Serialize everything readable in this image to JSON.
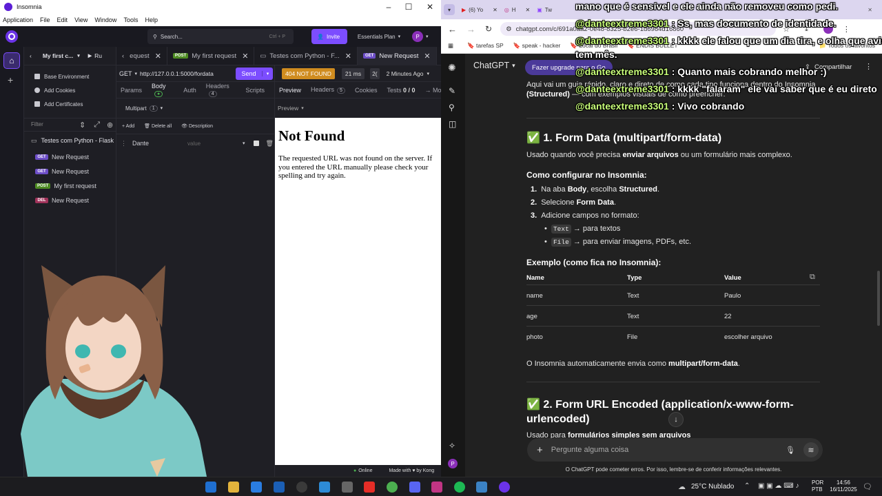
{
  "insomnia": {
    "window_title": "Insomnia",
    "menu": [
      "Application",
      "File",
      "Edit",
      "View",
      "Window",
      "Tools",
      "Help"
    ],
    "search_placeholder": "Search...",
    "search_shortcut": "Ctrl + P",
    "invite_label": "Invite",
    "plan_label": "Essentials Plan",
    "avatar_letter": "P",
    "collection_short": "My first c...",
    "run_label": "Ru",
    "side_links": [
      "Base Environment",
      "Add Cookies",
      "Add Certificates"
    ],
    "filter_placeholder": "Filter",
    "collection_name": "Testes com Python - Flask",
    "requests": [
      {
        "method": "GET",
        "name": "New Request"
      },
      {
        "method": "GET",
        "name": "New Request"
      },
      {
        "method": "POST",
        "name": "My first request"
      },
      {
        "method": "DEL",
        "name": "New Request"
      }
    ],
    "tabs": [
      {
        "label": "equest",
        "method": "",
        "active": false
      },
      {
        "label": "My first request",
        "method": "POST",
        "active": false
      },
      {
        "label": "Testes com Python - F...",
        "method": "",
        "active": false
      },
      {
        "label": "New Request",
        "method": "GET",
        "active": true
      }
    ],
    "request": {
      "method": "GET",
      "url": "http://127.0.0.1:5000/fordata",
      "send_label": "Send",
      "subtabs": [
        "Params",
        "Body",
        "Auth",
        "Headers",
        "Scripts"
      ],
      "headers_count": "4",
      "body_type": "Multipart",
      "body_count": "1",
      "add_label": "Add",
      "delete_all_label": "Delete all",
      "description_label": "Description",
      "field_name": "Dante",
      "field_value_placeholder": "value"
    },
    "response": {
      "status": "404 NOT FOUND",
      "time": "21 ms",
      "size": "2(",
      "ago": "2 Minutes Ago",
      "subtabs": [
        "Preview",
        "Headers",
        "Cookies",
        "Tests",
        "→ Mock"
      ],
      "headers_count": "5",
      "tests_count": "0 / 0",
      "preview_label": "Preview",
      "heading": "Not Found",
      "message": "The requested URL was not found on the server. If you entered the URL manually please check your spelling and try again."
    },
    "footer_online": "Online",
    "footer_made": "Made with ♥ by Kong"
  },
  "chrome": {
    "tabs": [
      "(6) Yo",
      "H",
      "Tw"
    ],
    "address": "chatgpt.com/c/691a0aa2-0e48-8325-b2e6-1d6984d16860",
    "bookmarks": [
      "tarefas SP",
      "speak - hacker",
      "Local do Brasil",
      "ENDIS BULLET"
    ],
    "bookmarks_right": "Todos os favoritos"
  },
  "chatgpt": {
    "model_label": "ChatGPT",
    "upgrade_label": "Fazer upgrade para o Go",
    "share_label": "Compartilhar",
    "intro_1": "Aqui vai um guia rápido, claro e direto de como cada tipo funciona dentro do Insomnia",
    "intro_2_bold": "(Structured)",
    "intro_2_rest": " — com exemplos visuais de como preencher:",
    "section1_title": "✅ 1. Form Data (multipart/form-data)",
    "section1_desc_a": "Usado quando você precisa ",
    "section1_desc_b": "enviar arquivos",
    "section1_desc_c": " ou um formulário mais complexo.",
    "howto_title": "Como configurar no Insomnia:",
    "steps": [
      {
        "n": "1.",
        "a": "Na aba ",
        "b": "Body",
        "c": ", escolha ",
        "d": "Structured",
        "e": "."
      },
      {
        "n": "2.",
        "a": "Selecione ",
        "b": "Form Data",
        "c": ".",
        "d": "",
        "e": ""
      },
      {
        "n": "3.",
        "a": "Adicione campos no formato:",
        "b": "",
        "c": "",
        "d": "",
        "e": ""
      }
    ],
    "bullets": [
      {
        "code": "Text",
        "text": "→ para textos"
      },
      {
        "code": "File",
        "text": "→ para enviar imagens, PDFs, etc."
      }
    ],
    "example_title": "Exemplo (como fica no Insomnia):",
    "table_headers": [
      "Name",
      "Type",
      "Value"
    ],
    "table_rows": [
      [
        "name",
        "Text",
        "Paulo"
      ],
      [
        "age",
        "Text",
        "22"
      ],
      [
        "photo",
        "File",
        "escolher arquivo"
      ]
    ],
    "auto_a": "O Insomnia automaticamente envia como ",
    "auto_b": "multipart/form-data",
    "auto_c": ".",
    "section2_title_1": "✅ 2. Form URL Encoded (application/x-www-form-",
    "section2_title_2": "urlencoded)",
    "section2_desc_a": "Usado para ",
    "section2_desc_b": "formulários simples sem arquivos",
    "composer_placeholder": "Pergunte alguma coisa",
    "disclaimer": "O ChatGPT pode cometer erros. Por isso, lembre-se de conferir informações relevantes."
  },
  "stream_chat": [
    {
      "user": "",
      "text": "mano que é sensível e ele ainda não removeu como pedi."
    },
    {
      "user": "@danteextreme3301",
      "text": " : Ss, mas documento de identidade."
    },
    {
      "user": "@danteextreme3301",
      "text": " : kkkk ele falou que um dia tira, e olha que avisei"
    },
    {
      "user": "",
      "text": "tem mês."
    },
    {
      "user": "@danteextreme3301",
      "text": " : Quanto mais cobrando melhor :)"
    },
    {
      "user": "@danteextreme3301",
      "text": " : kkkk \"falaram\" ele vai saber que é eu direto"
    },
    {
      "user": "@danteextreme3301",
      "text": " : Vivo cobrando"
    }
  ],
  "taskbar": {
    "weather": "25°C  Nublado",
    "lang_1": "POR",
    "lang_2": "PTB",
    "time": "14:56",
    "date": "16/11/2025"
  },
  "colors": {
    "insomnia_purple": "#7c4dff",
    "status_404": "#d08c1f",
    "gpt_bg": "#212121"
  }
}
